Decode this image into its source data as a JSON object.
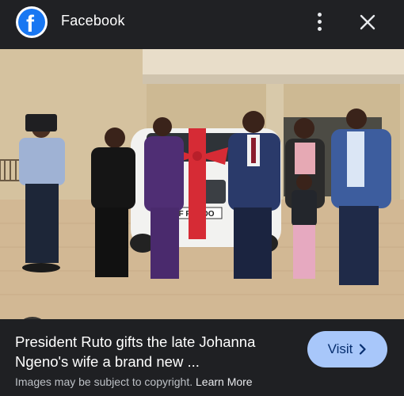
{
  "header": {
    "app_title": "Facebook",
    "logo_letter": "f",
    "icons": {
      "logo": "facebook-logo-icon",
      "more": "more-vert-icon",
      "close": "close-icon"
    }
  },
  "image": {
    "license_plate": "LF PRADO",
    "lens_icon": "google-lens-icon"
  },
  "caption": {
    "title": "President Ruto gifts the late Johanna Ngeno's wife a brand new ...",
    "visit_label": "Visit",
    "visit_icon": "chevron-right-icon",
    "copyright_text": "Images may be subject to copyright.",
    "learn_more": "Learn More"
  },
  "colors": {
    "background": "#1f2023",
    "visit_button": "#a8c7fa",
    "facebook_blue": "#1877f2"
  }
}
